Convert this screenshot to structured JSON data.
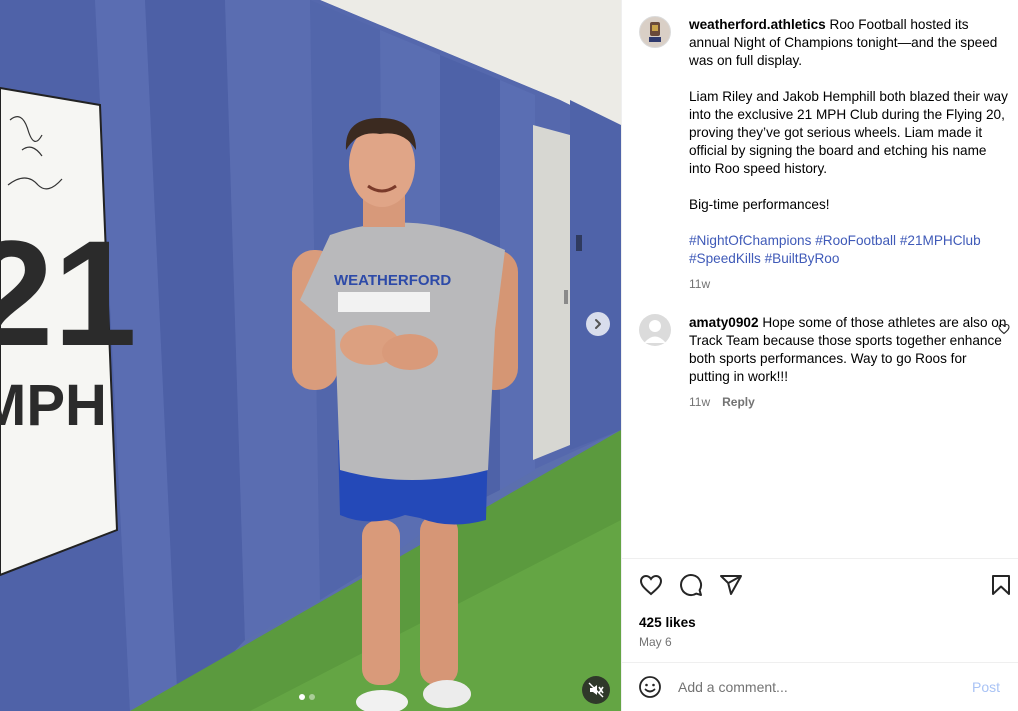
{
  "post": {
    "media": {
      "sign_number": "21",
      "sign_unit": "MPH",
      "shirt_text": "WEATHERFORD",
      "carousel_dots": 2,
      "active_dot": 1
    },
    "caption": {
      "username": "weatherford.athletics",
      "paragraphs": [
        "Roo Football hosted its annual Night of Champions tonight—and the speed was on full display.",
        "Liam Riley and Jakob Hemphill both blazed their way into the exclusive 21 MPH Club during the Flying 20, proving they’ve got serious wheels. Liam made it official by signing the board and etching his name into Roo speed history.",
        "Big-time performances!"
      ],
      "hashtags": [
        "#NightOfChampions",
        "#RooFootball",
        "#21MPHClub",
        "#SpeedKills",
        "#BuiltByRoo"
      ],
      "time": "11w"
    },
    "comments": [
      {
        "username": "amaty0902",
        "text": "Hope some of those athletes are also on Track Team because those sports together enhance both sports performances. Way to go Roos for putting in work!!!",
        "time": "11w",
        "reply_label": "Reply"
      }
    ],
    "likes": "425 likes",
    "date": "May 6",
    "add_comment": {
      "placeholder": "Add a comment...",
      "post_label": "Post"
    }
  },
  "icons": [
    "chevron-right-icon",
    "mute-icon",
    "heart-icon",
    "comment-icon",
    "share-icon",
    "bookmark-icon",
    "emoji-icon",
    "heart-small-icon"
  ],
  "colors": {
    "hashtag": "#3f5ab8",
    "secondary_text": "#737373",
    "post_button": "#a9c3f5",
    "divider": "#efefef"
  }
}
